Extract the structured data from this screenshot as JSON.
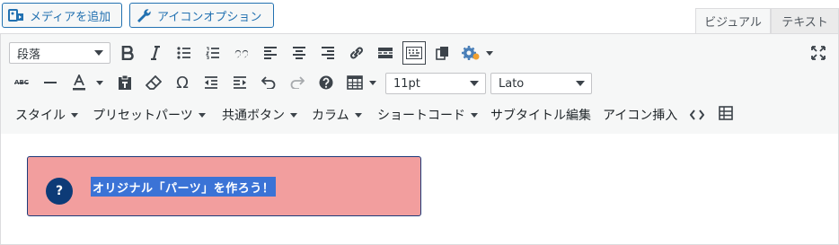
{
  "top": {
    "add_media_label": "メディアを追加",
    "icon_options_label": "アイコンオプション",
    "tab_visual": "ビジュアル",
    "tab_text": "テキスト"
  },
  "toolbar": {
    "format_select": "段落",
    "font_size_select": "11pt",
    "font_family_select": "Lato",
    "menus": [
      "スタイル",
      "プリセットパーツ",
      "共通ボタン",
      "カラム",
      "ショートコード",
      "サブタイトル編集",
      "アイコン挿入"
    ],
    "strikethrough_label": "ABC",
    "omega": "Ω"
  },
  "content": {
    "question_mark": "?",
    "callout_text": "オリジナル「パーツ」を作ろう！"
  }
}
